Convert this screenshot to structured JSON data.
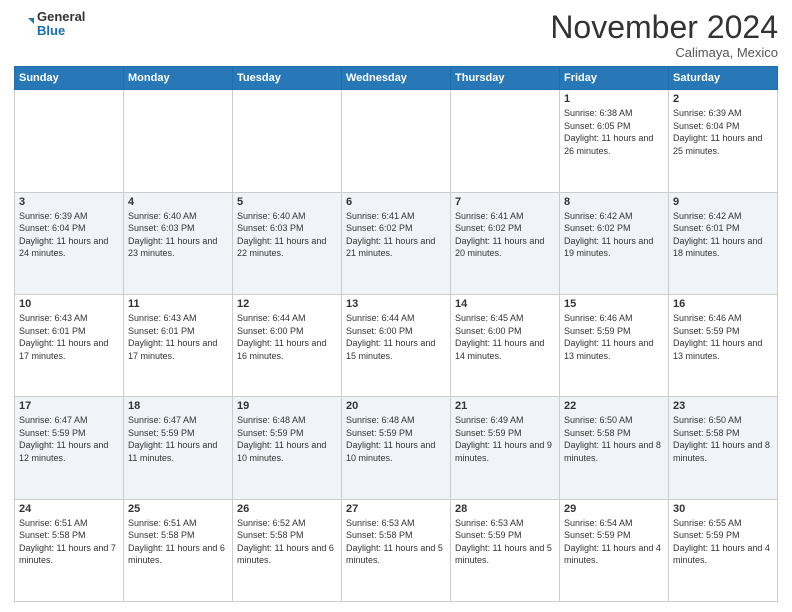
{
  "header": {
    "logo": {
      "general": "General",
      "blue": "Blue"
    },
    "month": "November 2024",
    "location": "Calimaya, Mexico"
  },
  "days_of_week": [
    "Sunday",
    "Monday",
    "Tuesday",
    "Wednesday",
    "Thursday",
    "Friday",
    "Saturday"
  ],
  "weeks": [
    [
      null,
      null,
      null,
      null,
      null,
      {
        "day": "1",
        "sunrise": "6:38 AM",
        "sunset": "6:05 PM",
        "daylight": "11 hours and 26 minutes."
      },
      {
        "day": "2",
        "sunrise": "6:39 AM",
        "sunset": "6:04 PM",
        "daylight": "11 hours and 25 minutes."
      }
    ],
    [
      {
        "day": "3",
        "sunrise": "6:39 AM",
        "sunset": "6:04 PM",
        "daylight": "11 hours and 24 minutes."
      },
      {
        "day": "4",
        "sunrise": "6:40 AM",
        "sunset": "6:03 PM",
        "daylight": "11 hours and 23 minutes."
      },
      {
        "day": "5",
        "sunrise": "6:40 AM",
        "sunset": "6:03 PM",
        "daylight": "11 hours and 22 minutes."
      },
      {
        "day": "6",
        "sunrise": "6:41 AM",
        "sunset": "6:02 PM",
        "daylight": "11 hours and 21 minutes."
      },
      {
        "day": "7",
        "sunrise": "6:41 AM",
        "sunset": "6:02 PM",
        "daylight": "11 hours and 20 minutes."
      },
      {
        "day": "8",
        "sunrise": "6:42 AM",
        "sunset": "6:02 PM",
        "daylight": "11 hours and 19 minutes."
      },
      {
        "day": "9",
        "sunrise": "6:42 AM",
        "sunset": "6:01 PM",
        "daylight": "11 hours and 18 minutes."
      }
    ],
    [
      {
        "day": "10",
        "sunrise": "6:43 AM",
        "sunset": "6:01 PM",
        "daylight": "11 hours and 17 minutes."
      },
      {
        "day": "11",
        "sunrise": "6:43 AM",
        "sunset": "6:01 PM",
        "daylight": "11 hours and 17 minutes."
      },
      {
        "day": "12",
        "sunrise": "6:44 AM",
        "sunset": "6:00 PM",
        "daylight": "11 hours and 16 minutes."
      },
      {
        "day": "13",
        "sunrise": "6:44 AM",
        "sunset": "6:00 PM",
        "daylight": "11 hours and 15 minutes."
      },
      {
        "day": "14",
        "sunrise": "6:45 AM",
        "sunset": "6:00 PM",
        "daylight": "11 hours and 14 minutes."
      },
      {
        "day": "15",
        "sunrise": "6:46 AM",
        "sunset": "5:59 PM",
        "daylight": "11 hours and 13 minutes."
      },
      {
        "day": "16",
        "sunrise": "6:46 AM",
        "sunset": "5:59 PM",
        "daylight": "11 hours and 13 minutes."
      }
    ],
    [
      {
        "day": "17",
        "sunrise": "6:47 AM",
        "sunset": "5:59 PM",
        "daylight": "11 hours and 12 minutes."
      },
      {
        "day": "18",
        "sunrise": "6:47 AM",
        "sunset": "5:59 PM",
        "daylight": "11 hours and 11 minutes."
      },
      {
        "day": "19",
        "sunrise": "6:48 AM",
        "sunset": "5:59 PM",
        "daylight": "11 hours and 10 minutes."
      },
      {
        "day": "20",
        "sunrise": "6:48 AM",
        "sunset": "5:59 PM",
        "daylight": "11 hours and 10 minutes."
      },
      {
        "day": "21",
        "sunrise": "6:49 AM",
        "sunset": "5:59 PM",
        "daylight": "11 hours and 9 minutes."
      },
      {
        "day": "22",
        "sunrise": "6:50 AM",
        "sunset": "5:58 PM",
        "daylight": "11 hours and 8 minutes."
      },
      {
        "day": "23",
        "sunrise": "6:50 AM",
        "sunset": "5:58 PM",
        "daylight": "11 hours and 8 minutes."
      }
    ],
    [
      {
        "day": "24",
        "sunrise": "6:51 AM",
        "sunset": "5:58 PM",
        "daylight": "11 hours and 7 minutes."
      },
      {
        "day": "25",
        "sunrise": "6:51 AM",
        "sunset": "5:58 PM",
        "daylight": "11 hours and 6 minutes."
      },
      {
        "day": "26",
        "sunrise": "6:52 AM",
        "sunset": "5:58 PM",
        "daylight": "11 hours and 6 minutes."
      },
      {
        "day": "27",
        "sunrise": "6:53 AM",
        "sunset": "5:58 PM",
        "daylight": "11 hours and 5 minutes."
      },
      {
        "day": "28",
        "sunrise": "6:53 AM",
        "sunset": "5:59 PM",
        "daylight": "11 hours and 5 minutes."
      },
      {
        "day": "29",
        "sunrise": "6:54 AM",
        "sunset": "5:59 PM",
        "daylight": "11 hours and 4 minutes."
      },
      {
        "day": "30",
        "sunrise": "6:55 AM",
        "sunset": "5:59 PM",
        "daylight": "11 hours and 4 minutes."
      }
    ]
  ],
  "labels": {
    "sunrise": "Sunrise:",
    "sunset": "Sunset:",
    "daylight": "Daylight:"
  }
}
